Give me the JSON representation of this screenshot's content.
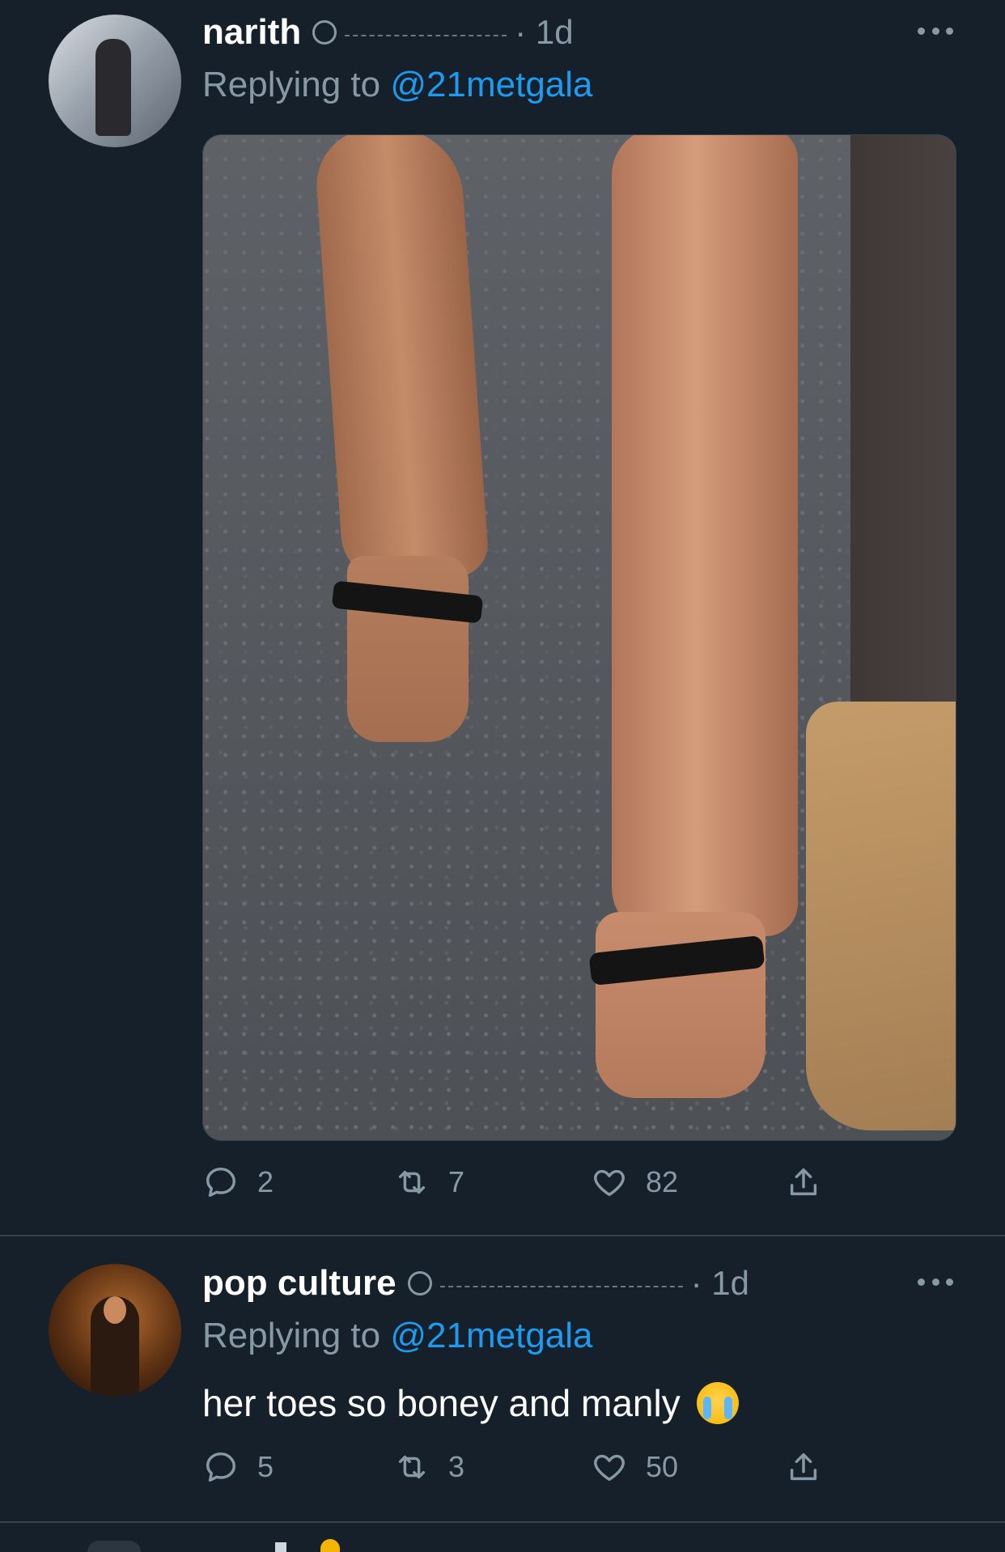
{
  "tweets": [
    {
      "name": "narith",
      "time": "1d",
      "replying_prefix": "Replying to",
      "replying_to": "@21metgala",
      "text": "",
      "stats": {
        "replies": "2",
        "retweets": "7",
        "likes": "82"
      }
    },
    {
      "name": "pop culture",
      "time": "1d",
      "replying_prefix": "Replying to",
      "replying_to": "@21metgala",
      "text": "her toes so boney and manly",
      "emoji": "loudly-crying-face",
      "stats": {
        "replies": "5",
        "retweets": "3",
        "likes": "50"
      }
    }
  ],
  "colors": {
    "background": "#15202b",
    "secondary_text": "#8899a6",
    "link": "#1d9bf0",
    "divider": "#38444d"
  }
}
